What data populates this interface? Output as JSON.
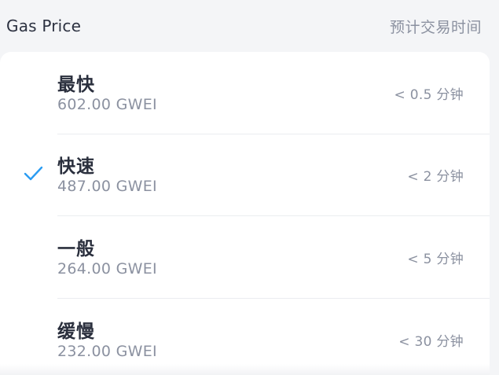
{
  "header": {
    "title": "Gas Price",
    "right_label": "预计交易时间"
  },
  "options": [
    {
      "name": "最快",
      "price": "602.00 GWEI",
      "time": "< 0.5 分钟",
      "selected": false
    },
    {
      "name": "快速",
      "price": "487.00 GWEI",
      "time": "< 2 分钟",
      "selected": true
    },
    {
      "name": "一般",
      "price": "264.00 GWEI",
      "time": "< 5 分钟",
      "selected": false
    },
    {
      "name": "缓慢",
      "price": "232.00 GWEI",
      "time": "< 30 分钟",
      "selected": false
    }
  ],
  "colors": {
    "accent": "#2b9cf2",
    "title_text": "#2a2f3d",
    "secondary_text": "#8b91a0",
    "background": "#f4f5f7",
    "card": "#ffffff"
  },
  "icons": {
    "selected_marker": "checkmark-icon"
  }
}
